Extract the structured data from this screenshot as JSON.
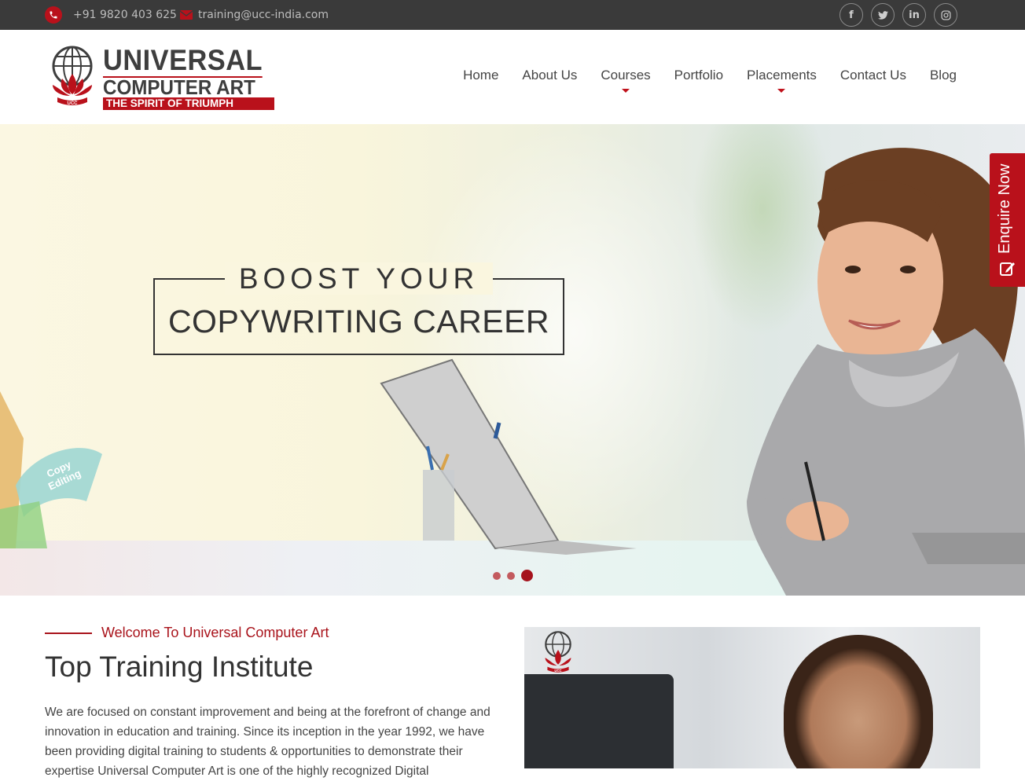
{
  "topbar": {
    "phone": "+91 9820 403 625",
    "email": "training@ucc-india.com",
    "social": [
      {
        "icon": "facebook-icon",
        "glyph": "f"
      },
      {
        "icon": "twitter-icon",
        "glyph": "t"
      },
      {
        "icon": "linkedin-icon",
        "glyph": "in"
      },
      {
        "icon": "instagram-icon",
        "glyph": "◎"
      }
    ]
  },
  "logo": {
    "line1": "UNIVERSAL",
    "line2": "COMPUTER ART",
    "line3": "THE SPIRIT OF TRIUMPH",
    "emblem": "UCC"
  },
  "nav": {
    "items": [
      {
        "label": "Home"
      },
      {
        "label": "About Us"
      },
      {
        "label": "Courses",
        "dropdown": true
      },
      {
        "label": "Portfolio"
      },
      {
        "label": "Placements",
        "dropdown": true
      },
      {
        "label": "Contact Us"
      },
      {
        "label": "Blog"
      }
    ]
  },
  "hero": {
    "headline_top": "BOOST YOUR",
    "headline_main": "COPYWRITING CAREER",
    "slides_total": 3,
    "active_slide": 3
  },
  "enquire": {
    "label": "Enquire Now"
  },
  "about": {
    "eyebrow": "Welcome To Universal Computer Art",
    "title": "Top Training Institute",
    "body": "We are focused on constant improvement and being at the forefront of change and innovation in education and training. Since its inception in the year 1992, we have been providing digital training to students & opportunities to demonstrate their expertise Universal Computer Art is one of the highly recognized Digital"
  },
  "colors": {
    "brand_red": "#b9111b",
    "topbar_bg": "#3a3a3a",
    "text_dark": "#333333"
  }
}
